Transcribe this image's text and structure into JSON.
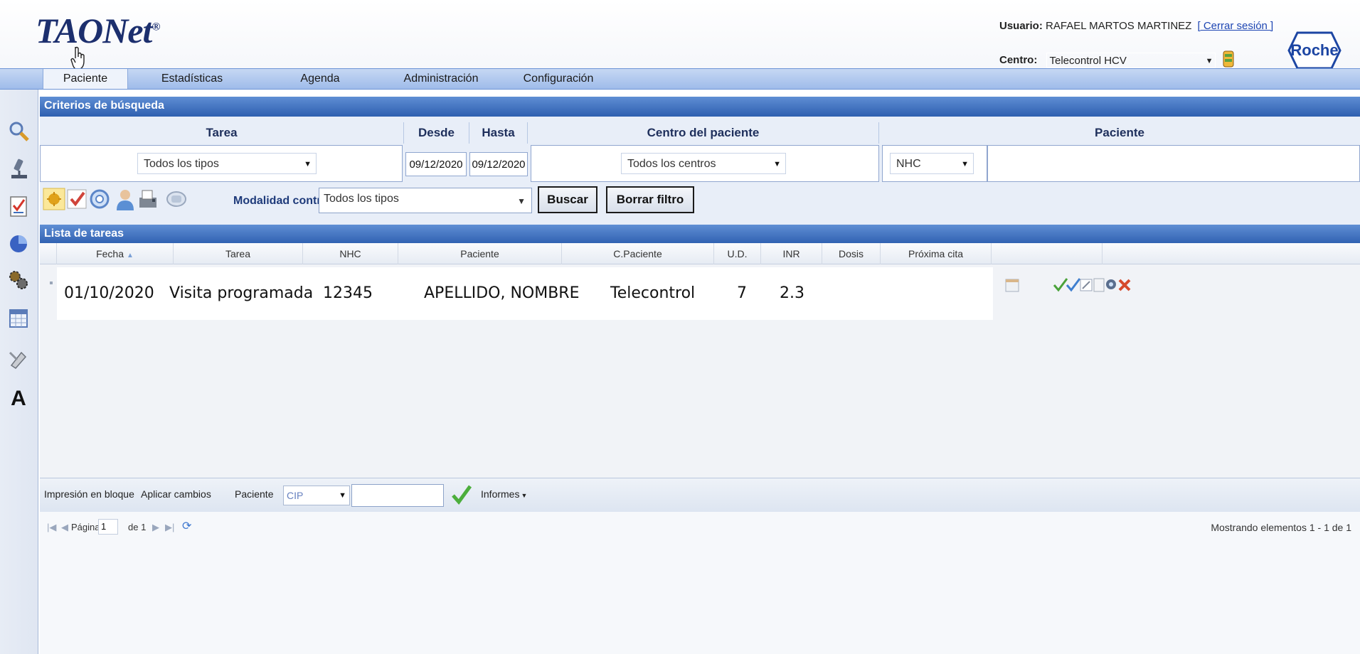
{
  "header": {
    "logo": "TAONet",
    "logo_mark": "®",
    "user_label": "Usuario:",
    "user_name": "RAFAEL MARTOS MARTINEZ",
    "logout": "[ Cerrar sesión ]",
    "centro_label": "Centro:",
    "centro_value": "Telecontrol HCV",
    "brand": "Roche"
  },
  "menu": {
    "items": [
      "Paciente",
      "Estadísticas",
      "Agenda",
      "Administración",
      "Configuración"
    ],
    "active": "Paciente"
  },
  "rail_icons": [
    "search-icon",
    "microscope-icon",
    "checklist-icon",
    "pie-chart-icon",
    "gears-icon",
    "calendar-grid-icon",
    "tools-icon",
    "font-icon"
  ],
  "criteria": {
    "title": "Criterios de búsqueda",
    "headers": {
      "tarea": "Tarea",
      "desde": "Desde",
      "hasta": "Hasta",
      "centro": "Centro del paciente",
      "paciente": "Paciente"
    },
    "tarea_value": "Todos los tipos",
    "desde_value": "09/12/2020",
    "hasta_value": "09/12/2020",
    "centro_value": "Todos los centros",
    "paciente_type": "NHC",
    "paciente_value": ""
  },
  "filters": {
    "icons": [
      "warning-icon",
      "check-icon",
      "support-icon",
      "person-icon",
      "fax-icon",
      "phone-icon"
    ],
    "modalidad_label": "Modalidad control",
    "modalidad_value": "Todos los tipos",
    "search_button": "Buscar",
    "clear_button": "Borrar filtro"
  },
  "tasks": {
    "title": "Lista de tareas",
    "columns": [
      "Fecha",
      "Tarea",
      "NHC",
      "Paciente",
      "C.Paciente",
      "U.D.",
      "INR",
      "Dosis",
      "Próxima cita"
    ],
    "sort_indicator": "▲",
    "rows": [
      {
        "fecha": "01/10/2020",
        "tarea": "Visita programada",
        "nhc": "12345",
        "paciente": "APELLIDO, NOMBRE",
        "c_paciente": "Telecontrol",
        "ud": "7",
        "inr": "2.3",
        "dosis": "",
        "proxima_cita": ""
      }
    ]
  },
  "bottom": {
    "print_block": "Impresión en bloque",
    "apply_changes": "Aplicar cambios",
    "paciente_label": "Paciente",
    "paciente_type": "CIP",
    "paciente_value": "",
    "reports": "Informes"
  },
  "pager": {
    "page_label": "Página",
    "page_value": "1",
    "of_label": "de 1",
    "display_info": "Mostrando elementos 1 - 1 de 1"
  }
}
